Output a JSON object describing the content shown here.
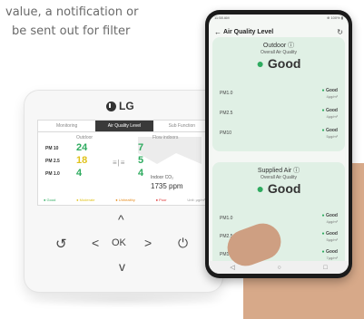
{
  "caption": {
    "line1": "value, a notification or",
    "line2": "be sent out for filter"
  },
  "controller": {
    "brand": "LG",
    "tabs": [
      "Monitoring",
      "Air Quality Level",
      "Sub Function"
    ],
    "active_tab": "Air Quality Level",
    "col_outdoor": "Outdoor",
    "col_flow": "Flow indoors",
    "rows": [
      {
        "label": "PM 10",
        "outdoor": "24",
        "indoor": "7"
      },
      {
        "label": "PM 2.5",
        "outdoor": "18",
        "indoor": "5"
      },
      {
        "label": "PM 1.0",
        "outdoor": "4",
        "indoor": "4"
      }
    ],
    "co2_label": "Indoor CO₂",
    "co2_value": "1735 ppm",
    "legend": [
      "● Good",
      "● Moderate",
      "● Unhealthy",
      "● Poor",
      "Unit: μg/m³"
    ],
    "pad": {
      "up": "^",
      "back": "↺",
      "left": "<",
      "ok": "OK",
      "right": ">",
      "power": "⏻",
      "down": "v"
    }
  },
  "phone": {
    "status_left": "11:58 AM",
    "status_right": "⊕ 100% ▮",
    "title": "Air Quality Level",
    "outdoor_card": {
      "title": "Outdoor ⓘ",
      "subtitle": "Overall Air Quality",
      "status": "Good",
      "rows": [
        {
          "name": "PM1.0",
          "status": "Good",
          "value": "4μg/m³"
        },
        {
          "name": "PM2.5",
          "status": "Good",
          "value": "4μg/m³"
        },
        {
          "name": "PM10",
          "status": "Good",
          "value": "5μg/m³"
        }
      ]
    },
    "supplied_card": {
      "title": "Supplied Air ⓘ",
      "subtitle": "Overall Air Quality",
      "status": "Good",
      "rows": [
        {
          "name": "PM1.0",
          "status": "Good",
          "value": "4μg/m³"
        },
        {
          "name": "PM2.5",
          "status": "Good",
          "value": "5μg/m³"
        },
        {
          "name": "PM10",
          "status": "Good",
          "value": "7μg/m³"
        }
      ]
    },
    "nav": [
      "◁",
      "○",
      "□"
    ]
  },
  "colors": {
    "good_green": "#2eab5f",
    "moderate_yellow": "#e0c21a",
    "card_bg": "#e0f0e5"
  }
}
